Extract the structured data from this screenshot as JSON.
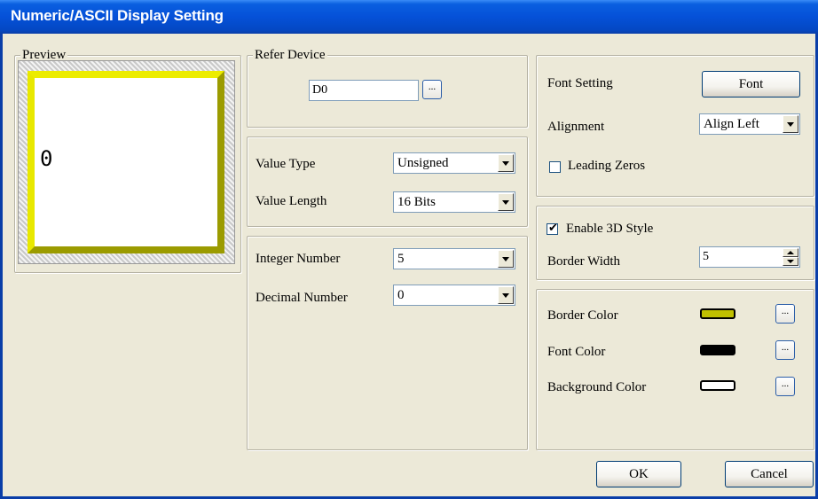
{
  "window": {
    "title": "Numeric/ASCII Display Setting"
  },
  "preview": {
    "legend": "Preview",
    "value": "0",
    "border_color": "#c8c800"
  },
  "refer_device": {
    "legend": "Refer Device",
    "value": "D0",
    "browse_label": "..."
  },
  "value_type": {
    "label": "Value Type",
    "selected": "Unsigned"
  },
  "value_length": {
    "label": "Value Length",
    "selected": "16 Bits"
  },
  "integer_number": {
    "label": "Integer Number",
    "selected": "5"
  },
  "decimal_number": {
    "label": "Decimal Number",
    "selected": "0"
  },
  "font_setting": {
    "label": "Font Setting",
    "button_label": "Font"
  },
  "alignment": {
    "label": "Alignment",
    "selected": "Align Left"
  },
  "leading_zeros": {
    "label": "Leading Zeros",
    "checked": false
  },
  "enable_3d": {
    "label": "Enable 3D Style",
    "checked": true,
    "check_glyph": "✔"
  },
  "border_width": {
    "label": "Border Width",
    "value": "5"
  },
  "colors": {
    "border": {
      "label": "Border Color",
      "swatch": "#c0c000",
      "browse_label": "..."
    },
    "font": {
      "label": "Font Color",
      "swatch": "#000000",
      "browse_label": "..."
    },
    "background": {
      "label": "Background Color",
      "swatch": "#ffffff",
      "browse_label": "..."
    }
  },
  "buttons": {
    "ok": "OK",
    "cancel": "Cancel"
  },
  "icons": {
    "dropdown": "chevron-down-icon",
    "spin_up": "spin-up-icon",
    "spin_down": "spin-down-icon",
    "checkmark": "checkmark-icon"
  }
}
